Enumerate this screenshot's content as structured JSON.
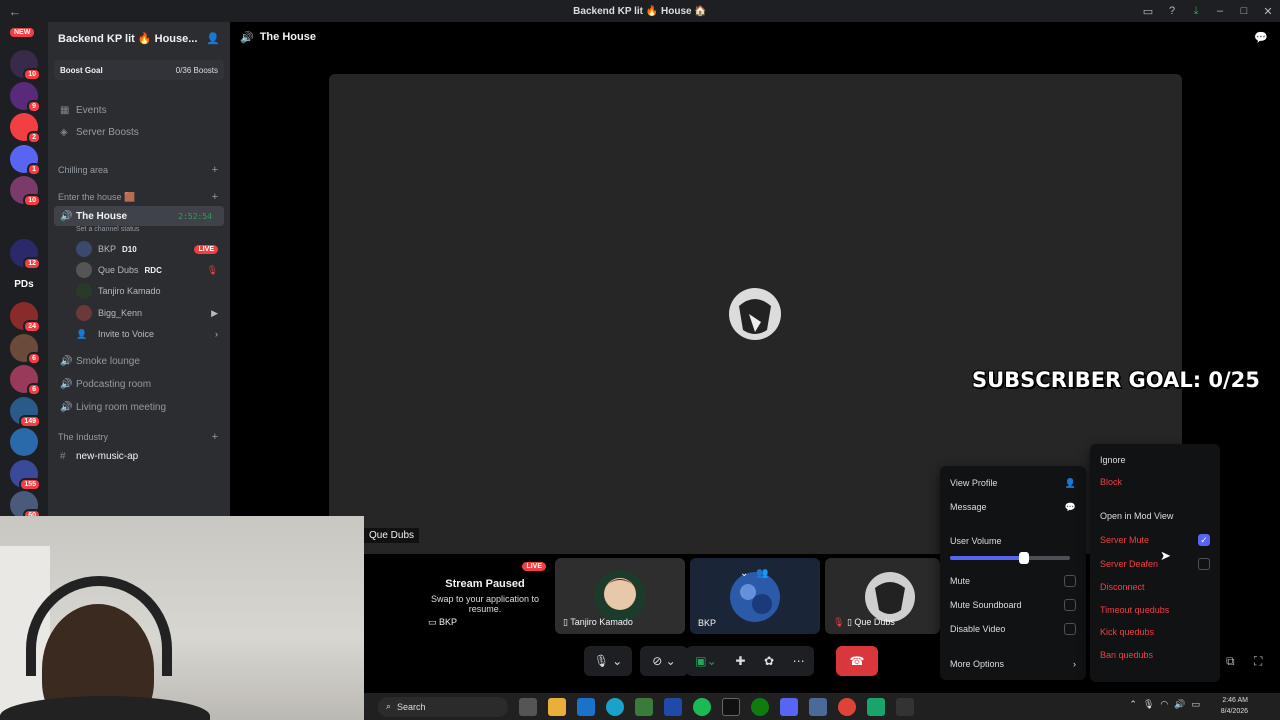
{
  "window": {
    "title": "Backend KP lit 🔥 House 🏠",
    "back_icon": "←",
    "icons": [
      "inbox-icon",
      "help-icon",
      "download-icon",
      "minimize-icon",
      "maximize-icon",
      "close-icon"
    ]
  },
  "rail": {
    "new_label": "NEW",
    "servers": [
      {
        "name": "server-1",
        "badge": "10",
        "color": "#3a2a4a"
      },
      {
        "name": "server-2",
        "badge": "9",
        "color": "#5a2a7a"
      },
      {
        "name": "server-3",
        "badge": "2",
        "color": "#f23f43"
      },
      {
        "name": "server-4",
        "badge": "1",
        "color": "#5865f2"
      },
      {
        "name": "server-5",
        "badge": "10",
        "color": "#7a3a6a"
      },
      {
        "name": "server-6",
        "badge": "",
        "color": "#1e1f22"
      },
      {
        "name": "server-7",
        "badge": "12",
        "color": "#2a2a6a"
      },
      {
        "name": "server-8",
        "label": "PDs",
        "badge": "",
        "color": "#1e1f22"
      },
      {
        "name": "server-9",
        "badge": "24",
        "color": "#8a2a2a"
      },
      {
        "name": "server-10",
        "badge": "6",
        "color": "#6a4a3a"
      },
      {
        "name": "server-11",
        "badge": "6",
        "color": "#9a3a5a"
      },
      {
        "name": "server-12",
        "badge": "149",
        "color": "#2a5a8a"
      },
      {
        "name": "server-13",
        "badge": "",
        "color": "#2a6aaa"
      },
      {
        "name": "server-14",
        "badge": "155",
        "color": "#3a4a9a"
      },
      {
        "name": "server-15",
        "badge": "60",
        "color": "#4a5a7a"
      }
    ]
  },
  "sidebar": {
    "server_name": "Backend KP lit 🔥 House...",
    "boost_goal": "Boost Goal",
    "boost_count": "0/36 Boosts",
    "events": "Events",
    "server_boosts": "Server Boosts",
    "cat_chilling": "Chilling area",
    "cat_enter": "Enter the house 🟫",
    "active_channel": "The House",
    "active_timer": "2:52:54",
    "channel_status": "Set a channel status",
    "voice_users": [
      {
        "name": "BKP",
        "tag": "D10",
        "live": "LIVE"
      },
      {
        "name": "Que Dubs",
        "tag": "RDC"
      },
      {
        "name": "Tanjiro Kamado"
      },
      {
        "name": "Bigg_Kenn"
      }
    ],
    "invite": "Invite to Voice",
    "channels": [
      "Smoke lounge",
      "Podcasting room",
      "Living room meeting"
    ],
    "cat_industry": "The Industry",
    "text_channel": "new-music-ap"
  },
  "main": {
    "channel_title": "The House",
    "overlay_text": "SUBSCRIBER GOAL: 0/25",
    "focused_user": "Que Dubs"
  },
  "stream_paused": {
    "title": "Stream Paused",
    "subtitle": "Swap to your application to resume.",
    "live": "LIVE",
    "user": "BKP"
  },
  "tiles": {
    "tanjiro": "Tanjiro Kamado",
    "bkp": "BKP",
    "quedubs": "Que Dubs"
  },
  "user_menu": {
    "view_profile": "View Profile",
    "message": "Message",
    "user_volume": "User Volume",
    "volume_level": 0.62,
    "mute": "Mute",
    "mute_soundboard": "Mute Soundboard",
    "disable_video": "Disable Video",
    "more_options": "More Options"
  },
  "mod_menu": {
    "ignore": "Ignore",
    "block": "Block",
    "open_mod_view": "Open in Mod View",
    "server_mute": "Server Mute",
    "server_mute_checked": true,
    "server_deafen": "Server Deafen",
    "disconnect": "Disconnect",
    "timeout": "Timeout quedubs",
    "kick": "Kick quedubs",
    "ban": "Ban quedubs"
  },
  "taskbar": {
    "search": "Search",
    "time": "2:46 AM",
    "date": "8/4/2026"
  },
  "colors": {
    "accent": "#5865f2",
    "danger": "#f23f43",
    "online": "#23a55a"
  }
}
